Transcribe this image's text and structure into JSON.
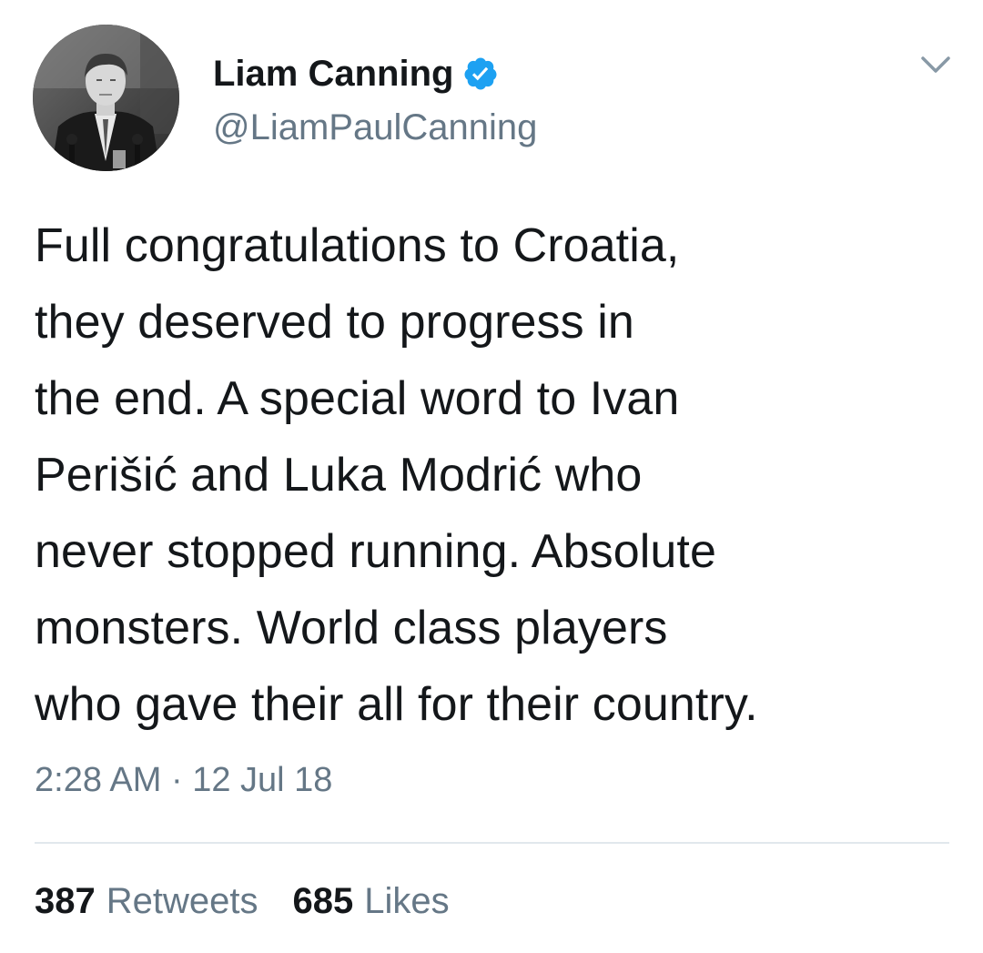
{
  "tweet": {
    "author": {
      "display_name": "Liam Canning",
      "handle": "@LiamPaulCanning",
      "verified": true
    },
    "text": "Full congratulations to Croatia,\nthey deserved to progress in\nthe end. A special word to Ivan\nPerišić and Luka Modrić who\nnever stopped running. Absolute\nmonsters. World class players\nwho gave their all for their country.",
    "timestamp": "2:28 AM · 12 Jul 18",
    "stats": {
      "retweets_count": "387",
      "retweets_label": "Retweets",
      "likes_count": "685",
      "likes_label": "Likes"
    }
  },
  "icons": {
    "verified": "verified-badge-icon",
    "menu": "chevron-down-icon"
  },
  "colors": {
    "text_primary": "#14171a",
    "text_secondary": "#657786",
    "verified_blue": "#1da1f2",
    "divider": "#e1e8ed"
  }
}
